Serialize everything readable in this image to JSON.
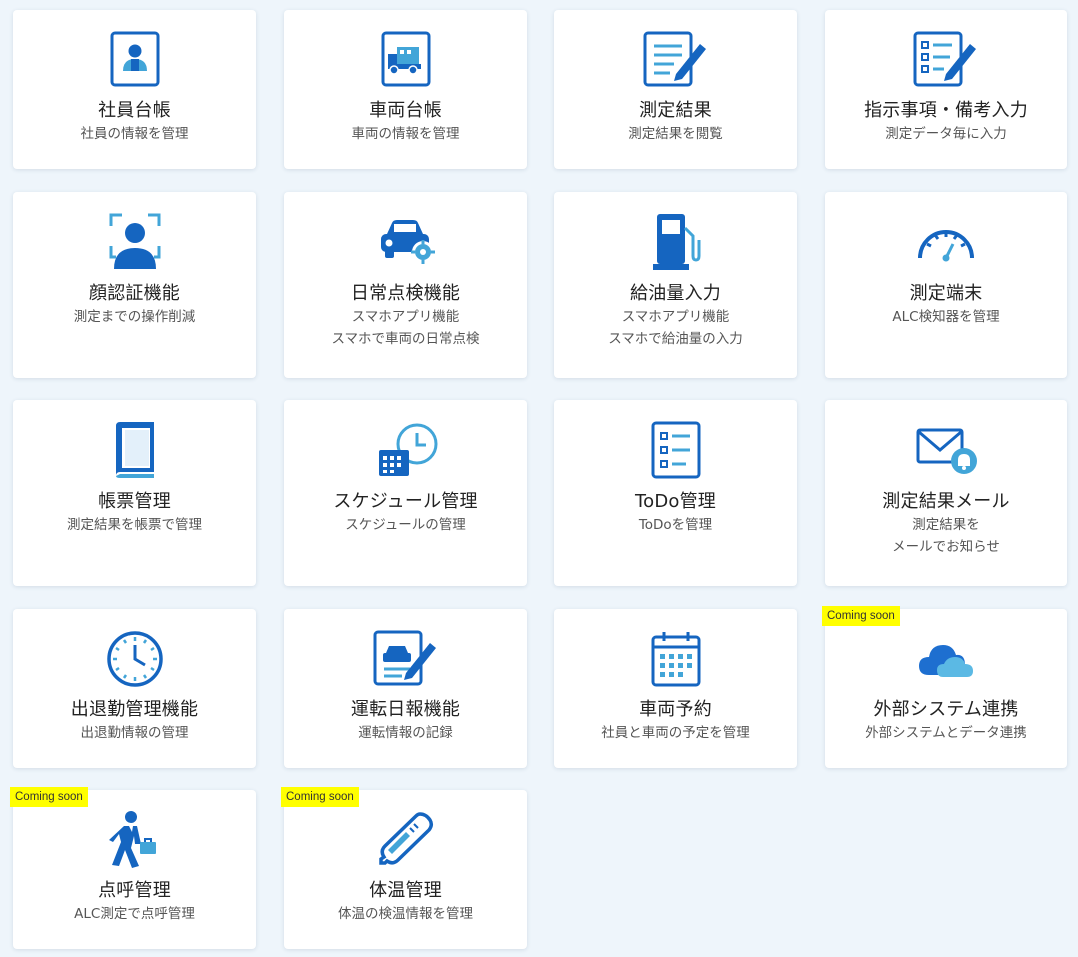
{
  "colors": {
    "icon_blue": "#1565c0",
    "icon_light": "#42a5d8",
    "badge": "#ffff00"
  },
  "cards": [
    {
      "icon": "employee-ledger-icon",
      "title": "社員台帳",
      "desc": [
        "社員の情報を管理"
      ]
    },
    {
      "icon": "vehicle-ledger-icon",
      "title": "車両台帳",
      "desc": [
        "車両の情報を管理"
      ]
    },
    {
      "icon": "document-edit-icon",
      "title": "測定結果",
      "desc": [
        "測定結果を閲覧"
      ]
    },
    {
      "icon": "checklist-edit-icon",
      "title": "指示事項・備考入力",
      "desc": [
        "測定データ毎に入力"
      ]
    },
    {
      "icon": "face-recognition-icon",
      "title": "顔認証機能",
      "desc": [
        "測定までの操作削減"
      ]
    },
    {
      "icon": "car-gear-icon",
      "title": "日常点検機能",
      "desc": [
        "スマホアプリ機能",
        "スマホで車両の日常点検"
      ]
    },
    {
      "icon": "fuel-pump-icon",
      "title": "給油量入力",
      "desc": [
        "スマホアプリ機能",
        "スマホで給油量の入力"
      ]
    },
    {
      "icon": "gauge-icon",
      "title": "測定端末",
      "desc": [
        "ALC検知器を管理"
      ]
    },
    {
      "icon": "book-icon",
      "title": "帳票管理",
      "desc": [
        "測定結果を帳票で管理"
      ]
    },
    {
      "icon": "calendar-clock-icon",
      "title": "スケジュール管理",
      "desc": [
        "スケジュールの管理"
      ]
    },
    {
      "icon": "checklist-icon",
      "title": "ToDo管理",
      "desc": [
        "ToDoを管理"
      ]
    },
    {
      "icon": "mail-bell-icon",
      "title": "測定結果メール",
      "desc": [
        "測定結果を",
        "メールでお知らせ"
      ]
    },
    {
      "icon": "clock-icon",
      "title": "出退勤管理機能",
      "desc": [
        "出退勤情報の管理"
      ]
    },
    {
      "icon": "car-report-edit-icon",
      "title": "運転日報機能",
      "desc": [
        "運転情報の記録"
      ]
    },
    {
      "icon": "calendar-icon",
      "title": "車両予約",
      "desc": [
        "社員と車両の予定を管理"
      ]
    },
    {
      "icon": "cloud-icon",
      "title": "外部システム連携",
      "desc": [
        "外部システムとデータ連携"
      ],
      "badge": "Coming soon"
    },
    {
      "icon": "walking-person-icon",
      "title": "点呼管理",
      "desc": [
        "ALC測定で点呼管理"
      ],
      "badge": "Coming soon"
    },
    {
      "icon": "thermometer-icon",
      "title": "体温管理",
      "desc": [
        "体温の検温情報を管理"
      ],
      "badge": "Coming soon"
    }
  ]
}
